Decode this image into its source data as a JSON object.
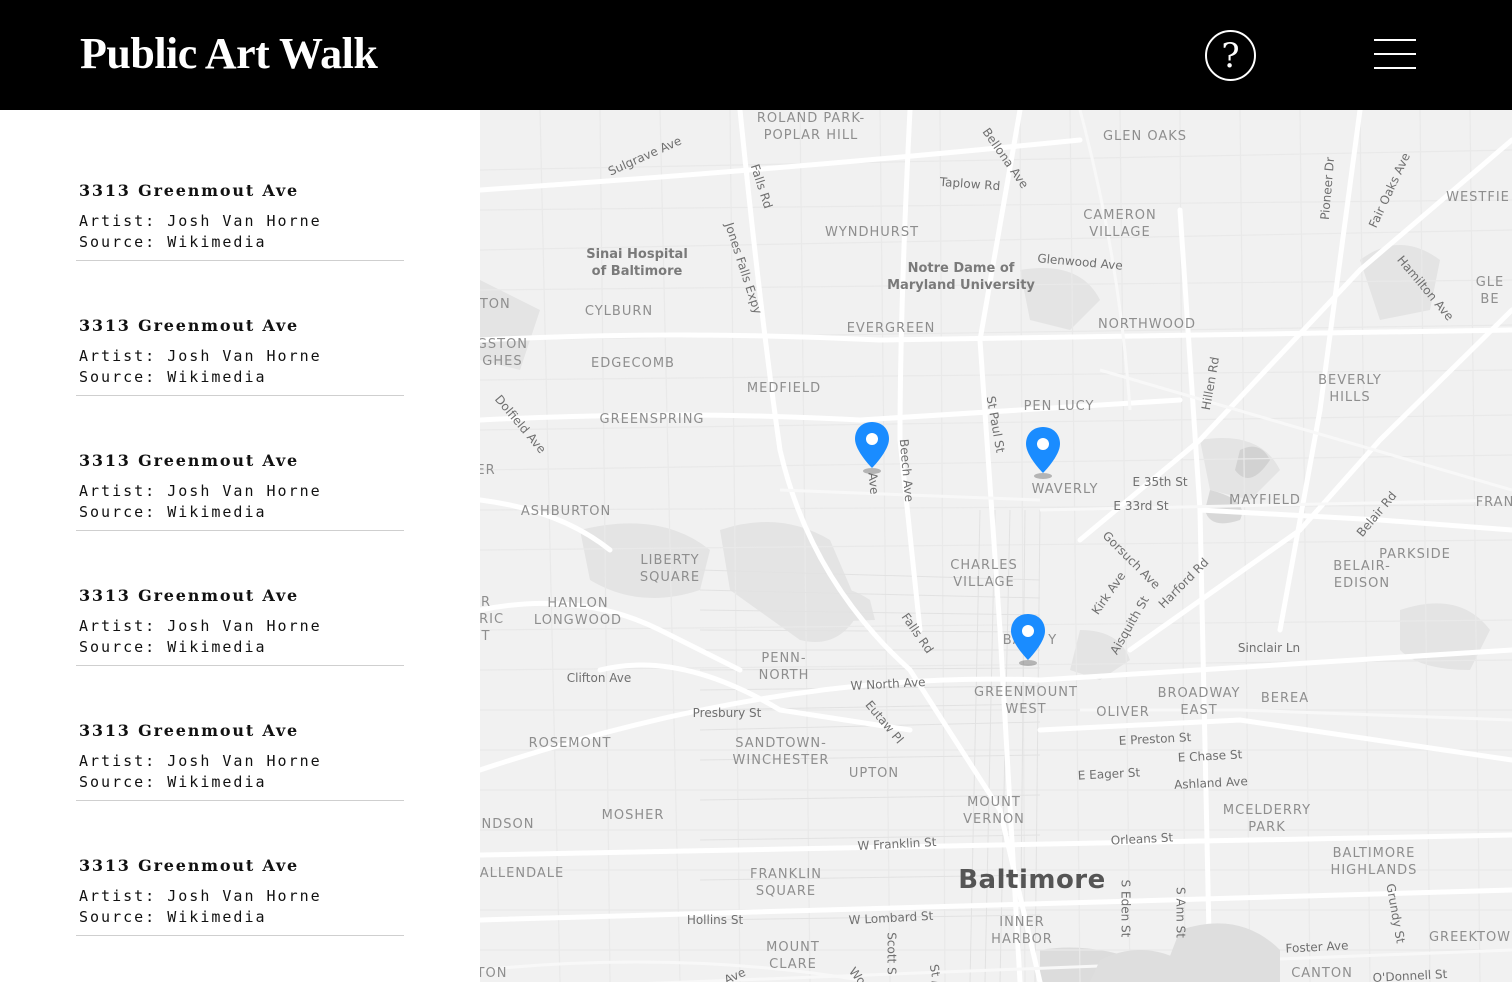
{
  "header": {
    "title": "Public Art Walk",
    "help_glyph": "?",
    "help_icon": "question-mark-icon",
    "menu_icon": "hamburger-menu-icon",
    "background": "#000000",
    "foreground": "#ffffff"
  },
  "artworks": [
    {
      "title": "3313 Greenmout Ave",
      "artist": "Artist: Josh Van Horne",
      "source": "Source: Wikimedia"
    },
    {
      "title": "3313 Greenmout Ave",
      "artist": "Artist: Josh Van Horne",
      "source": "Source: Wikimedia"
    },
    {
      "title": "3313 Greenmout Ave",
      "artist": "Artist: Josh Van Horne",
      "source": "Source: Wikimedia"
    },
    {
      "title": "3313 Greenmout Ave",
      "artist": "Artist: Josh Van Horne",
      "source": "Source: Wikimedia"
    },
    {
      "title": "3313 Greenmout Ave",
      "artist": "Artist: Josh Van Horne",
      "source": "Source: Wikimedia"
    },
    {
      "title": "3313 Greenmout Ave",
      "artist": "Artist: Josh Van Horne",
      "source": "Source: Wikimedia"
    }
  ],
  "map": {
    "pin_color": "#1a8cff",
    "pin_icon": "map-pin-icon",
    "city": "Baltimore",
    "neighborhoods": [
      "ROLAND PARK-\nPOPLAR HILL",
      "GLEN OAKS",
      "WYNDHURST",
      "CAMERON\nVILLAGE",
      "WESTFIE",
      "CYLBURN",
      "EVERGREEN",
      "NORTHWOOD",
      "GTON",
      "IGSTON\nIGHES",
      "EDGECOMB",
      "MEDFIELD",
      "PEN LUCY",
      "BEVERLY\nHILLS",
      "GREENSPRING",
      "WAVERLY",
      "MAYFIELD",
      "ER",
      "ASHBURTON",
      "LIBERTY\nSQUARE",
      "CHARLES\nVILLAGE",
      "BELAIR-\nEDISON",
      "PARKSIDE",
      "R\nORIC\nT",
      "HANLON\nLONGWOOD",
      "FRAN",
      "GLE\nBE",
      "PENN-\nNORTH",
      "GREENMOUNT\nWEST",
      "BROADWAY\nEAST",
      "BEREA",
      "OLIVER",
      "ROSEMONT",
      "SANDTOWN-\nWINCHESTER",
      "UPTON",
      "MOSHER",
      "MOUNT\nVERNON",
      "MCELDERRY\nPARK",
      "NDSON",
      "ALLENDALE",
      "FRANKLIN\nSQUARE",
      "BALTIMORE\nHIGHLANDS",
      "MOUNT\nCLARE",
      "INNER\nHARBOR",
      "CANTON",
      "GREEKTOW",
      "TON",
      "BA     Y"
    ],
    "places": [
      "Sinai Hospital\nof Baltimore",
      "Notre Dame of\nMaryland University"
    ],
    "streets": [
      "Sulgrave Ave",
      "Falls Rd",
      "Bellona Ave",
      "Taplow Rd",
      "Pioneer Dr",
      "Fair Oaks Ave",
      "Jones Falls Expy",
      "Glenwood Ave",
      "Hamilton Ave",
      "Dolfield Ave",
      "St Paul St",
      "Hillen Rd",
      "Beech Ave",
      "Ave",
      "E 35th St",
      "E 33rd St",
      "Belair Rd",
      "Gorsuch Ave",
      "Kirk Ave",
      "Harford Rd",
      "Aisquith St",
      "Falls Rd",
      "Sinclair Ln",
      "Clifton Ave",
      "W North Ave",
      "Presbury St",
      "Eutaw Pl",
      "E Preston St",
      "E Chase St",
      "E Eager St",
      "Ashland Ave",
      "Orleans St",
      "W Franklin St",
      "W Lombard St",
      "Hollins St",
      "S Eden St",
      "S Ann St",
      "Grundy St",
      "Foster Ave",
      "O'Donnell St",
      "Scott S",
      "Ave",
      "Wo",
      "St /"
    ]
  }
}
